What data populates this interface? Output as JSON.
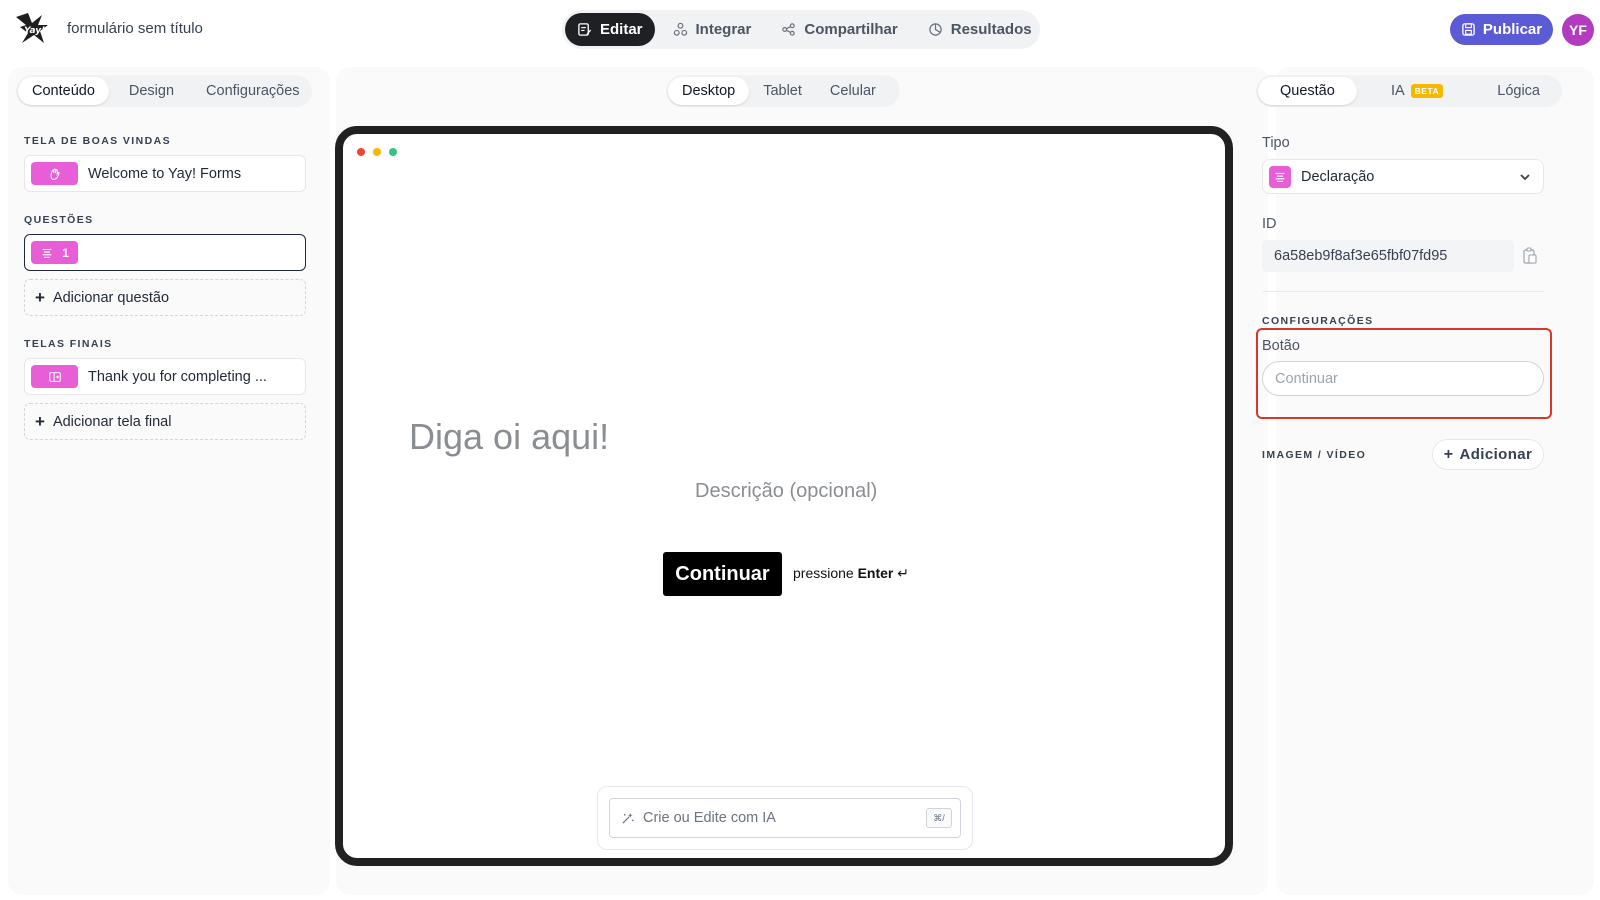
{
  "app": {
    "form_title": "formulário sem título",
    "logo_text": "Yay!"
  },
  "topnav": {
    "items": [
      {
        "label": "Editar",
        "icon": "edit-icon",
        "active": true
      },
      {
        "label": "Integrar",
        "icon": "integrate-icon",
        "active": false
      },
      {
        "label": "Compartilhar",
        "icon": "share-icon",
        "active": false
      },
      {
        "label": "Resultados",
        "icon": "results-icon",
        "active": false
      }
    ],
    "publish_label": "Publicar",
    "avatar_initials": "YF"
  },
  "left_panel": {
    "tabs": [
      {
        "label": "Conteúdo",
        "active": true
      },
      {
        "label": "Design",
        "active": false
      },
      {
        "label": "Configurações",
        "active": false
      }
    ],
    "welcome_section": "TELA DE BOAS VINDAS",
    "welcome_item": "Welcome to Yay! Forms",
    "questions_section": "QUESTÕES",
    "question_number": "1",
    "add_question": "Adicionar questão",
    "end_section": "TELAS FINAIS",
    "end_item": "Thank you for completing ...",
    "add_end_screen": "Adicionar tela final"
  },
  "middle_panel": {
    "device_tabs": [
      {
        "label": "Desktop",
        "active": true
      },
      {
        "label": "Tablet",
        "active": false
      },
      {
        "label": "Celular",
        "active": false
      }
    ],
    "headline": "Diga oi aqui!",
    "description": "Descrição (opcional)",
    "continue_label": "Continuar",
    "press_prefix": "pressione",
    "press_key": "Enter",
    "ai_placeholder": "Crie ou Edite com IA",
    "ai_shortcut": "⌘/"
  },
  "right_panel": {
    "tabs": [
      {
        "label": "Questão",
        "active": true
      },
      {
        "label": "IA",
        "active": false,
        "badge": "BETA"
      },
      {
        "label": "Lógica",
        "active": false
      }
    ],
    "type_label": "Tipo",
    "type_value": "Declaração",
    "id_label": "ID",
    "id_value": "6a58eb9f8af3e65fbf07fd95",
    "settings_section": "CONFIGURAÇÕES",
    "button_label": "Botão",
    "button_placeholder": "Continuar",
    "media_section": "IMAGEM / VÍDEO",
    "add_media": "Adicionar"
  },
  "colors": {
    "accent_pink": "#e85ed7",
    "publish_purple": "#5b5bd6",
    "avatar_purple": "#b23bc0",
    "highlight_red": "#d7382d",
    "dot_red": "#f04438",
    "dot_yellow": "#f5b800",
    "dot_green": "#33c481"
  }
}
